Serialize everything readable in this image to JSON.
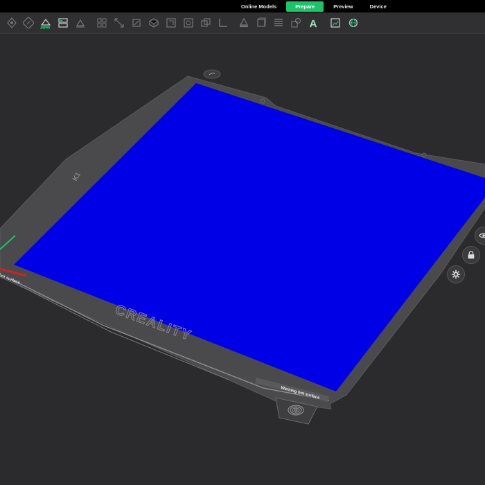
{
  "topbar": {
    "tabs": [
      {
        "label": "Online Models",
        "active": false
      },
      {
        "label": "Prepare",
        "active": true
      },
      {
        "label": "Preview",
        "active": false
      },
      {
        "label": "Device",
        "active": false
      }
    ],
    "accent_color": "#1ec26a"
  },
  "toolbar": {
    "auto_label": "AUTO",
    "icons": [
      "add-object-icon",
      "orient-icon",
      "auto-orient-icon",
      "arrange-icon",
      "layflat-icon",
      "split-icon",
      "scale-icon",
      "rotate-icon",
      "cut-icon",
      "mirror-icon",
      "support-icon",
      "seam-icon",
      "assemble-icon",
      "measure-icon",
      "emboss-icon",
      "variable-layer-icon",
      "boolean-icon",
      "text-icon",
      "view-options-icon",
      "network-icon"
    ],
    "text_tool_glyph": "A"
  },
  "bed": {
    "surface_color": "#0000e6",
    "brand_text": "CREALITY",
    "warning_text": "Warning hot surface",
    "corner_text": "hot surface",
    "model_marker": "K1"
  },
  "side_controls": [
    "eye-icon",
    "lock-icon",
    "gear-icon"
  ]
}
